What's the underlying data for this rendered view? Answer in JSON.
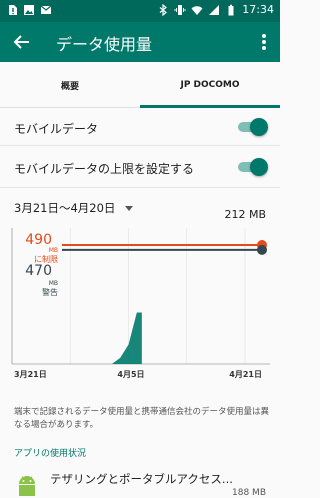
{
  "status_bar": {
    "time": "17:34",
    "left_icons": [
      "sim-card-alert-icon",
      "image-icon",
      "gmail-icon"
    ],
    "right_icons": [
      "bluetooth-icon",
      "vibrate-icon",
      "wifi-icon",
      "signal-icon",
      "battery-icon"
    ]
  },
  "toolbar": {
    "title": "データ使用量",
    "back_icon": "arrow-back-icon",
    "more_icon": "more-vert-icon"
  },
  "tabs": [
    {
      "label": "概要",
      "selected": false
    },
    {
      "label": "JP DOCOMO",
      "selected": true
    }
  ],
  "settings": {
    "mobile_data": {
      "label": "モバイルデータ",
      "enabled": true
    },
    "mobile_data_limit": {
      "label": "モバイルデータの上限を設定する",
      "enabled": true
    }
  },
  "cycle": {
    "label": "3月21日〜4月20日",
    "total": "212 MB"
  },
  "chart_data": {
    "type": "area",
    "x_tick_labels": [
      "3月21日",
      "4月5日",
      "4月21日"
    ],
    "limit": {
      "value": "490",
      "unit": "MB",
      "label": "に制限",
      "color": "#e64a19"
    },
    "warning": {
      "value": "470",
      "unit": "MB",
      "label": "警告",
      "color": "#37474f"
    },
    "ylim_mb": [
      0,
      560
    ],
    "usage_series_mb": [
      {
        "day": 0,
        "mb": 0
      },
      {
        "day": 12,
        "mb": 0
      },
      {
        "day": 13,
        "mb": 25
      },
      {
        "day": 14,
        "mb": 80
      },
      {
        "day": 15,
        "mb": 212
      },
      {
        "day": 31,
        "mb": 212
      }
    ],
    "usage_color": "#00796b"
  },
  "note": "端末で記録されるデータ使用量と携帯通信会社のデータ使用量は異なる場合があります。",
  "app_usage": {
    "section_title": "アプリの使用状況",
    "apps": [
      {
        "name": "テザリングとポータブルアクセス...",
        "size": "188 MB",
        "icon": "android-icon"
      }
    ]
  }
}
